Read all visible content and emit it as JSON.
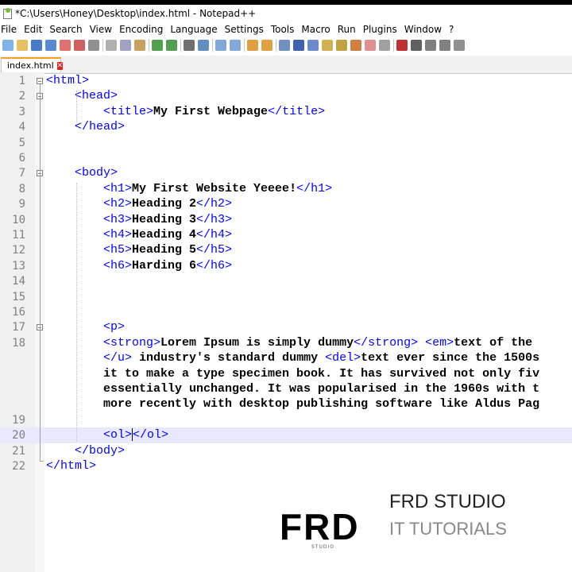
{
  "window": {
    "title": "*C:\\Users\\Honey\\Desktop\\index.html - Notepad++"
  },
  "menu": [
    "File",
    "Edit",
    "Search",
    "View",
    "Encoding",
    "Language",
    "Settings",
    "Tools",
    "Macro",
    "Run",
    "Plugins",
    "Window",
    "?"
  ],
  "tab": {
    "label": "index.html"
  },
  "editor": {
    "lines": [
      {
        "n": "1",
        "parts": [
          [
            "tag",
            "<html>"
          ]
        ]
      },
      {
        "n": "2",
        "parts": [
          [
            "sp",
            "    "
          ],
          [
            "tag",
            "<head>"
          ]
        ]
      },
      {
        "n": "3",
        "parts": [
          [
            "sp",
            "        "
          ],
          [
            "tag",
            "<title>"
          ],
          [
            "txt",
            "My First Webpage"
          ],
          [
            "tag",
            "</title>"
          ]
        ]
      },
      {
        "n": "4",
        "parts": [
          [
            "sp",
            "    "
          ],
          [
            "tag",
            "</head>"
          ]
        ]
      },
      {
        "n": "5",
        "parts": []
      },
      {
        "n": "6",
        "parts": []
      },
      {
        "n": "7",
        "parts": [
          [
            "sp",
            "    "
          ],
          [
            "tag",
            "<body>"
          ]
        ]
      },
      {
        "n": "8",
        "parts": [
          [
            "sp",
            "        "
          ],
          [
            "tag",
            "<h1>"
          ],
          [
            "txt",
            "My First Website Yeeee!"
          ],
          [
            "tag",
            "</h1>"
          ]
        ]
      },
      {
        "n": "9",
        "parts": [
          [
            "sp",
            "        "
          ],
          [
            "tag",
            "<h2>"
          ],
          [
            "txt",
            "Heading 2"
          ],
          [
            "tag",
            "</h2>"
          ]
        ]
      },
      {
        "n": "10",
        "parts": [
          [
            "sp",
            "        "
          ],
          [
            "tag",
            "<h3>"
          ],
          [
            "txt",
            "Heading 3"
          ],
          [
            "tag",
            "</h3>"
          ]
        ]
      },
      {
        "n": "11",
        "parts": [
          [
            "sp",
            "        "
          ],
          [
            "tag",
            "<h4>"
          ],
          [
            "txt",
            "Heading 4"
          ],
          [
            "tag",
            "</h4>"
          ]
        ]
      },
      {
        "n": "12",
        "parts": [
          [
            "sp",
            "        "
          ],
          [
            "tag",
            "<h5>"
          ],
          [
            "txt",
            "Heading 5"
          ],
          [
            "tag",
            "</h5>"
          ]
        ]
      },
      {
        "n": "13",
        "parts": [
          [
            "sp",
            "        "
          ],
          [
            "tag",
            "<h6>"
          ],
          [
            "txt",
            "Harding 6"
          ],
          [
            "tag",
            "</h6>"
          ]
        ]
      },
      {
        "n": "14",
        "parts": []
      },
      {
        "n": "15",
        "parts": []
      },
      {
        "n": "16",
        "parts": []
      },
      {
        "n": "17",
        "parts": [
          [
            "sp",
            "        "
          ],
          [
            "tag",
            "<p>"
          ]
        ]
      },
      {
        "n": "18",
        "parts": [
          [
            "sp",
            "        "
          ],
          [
            "tag",
            "<strong>"
          ],
          [
            "txt",
            "Lorem Ipsum is simply dummy"
          ],
          [
            "tag",
            "</strong>"
          ],
          [
            "txt",
            " "
          ],
          [
            "tag",
            "<em>"
          ],
          [
            "txt",
            "text of the "
          ]
        ]
      },
      {
        "n": "",
        "parts": [
          [
            "sp",
            "        "
          ],
          [
            "tag",
            "</u>"
          ],
          [
            "txt",
            " industry's standard dummy "
          ],
          [
            "tag",
            "<del>"
          ],
          [
            "txt",
            "text ever since the 1500s"
          ]
        ]
      },
      {
        "n": "",
        "parts": [
          [
            "sp",
            "        "
          ],
          [
            "txt",
            "it to make a type specimen book. It has survived not only fiv"
          ]
        ]
      },
      {
        "n": "",
        "parts": [
          [
            "sp",
            "        "
          ],
          [
            "txt",
            "essentially unchanged. It was popularised in the 1960s with t"
          ]
        ]
      },
      {
        "n": "",
        "parts": [
          [
            "sp",
            "        "
          ],
          [
            "txt",
            "more recently with desktop publishing software like Aldus Pag"
          ]
        ]
      },
      {
        "n": "19",
        "parts": []
      },
      {
        "n": "20",
        "parts": [
          [
            "sp",
            "        "
          ],
          [
            "tag",
            "<ol>"
          ],
          [
            "caret",
            ""
          ],
          [
            "tag",
            "</ol>"
          ]
        ]
      },
      {
        "n": "21",
        "parts": [
          [
            "sp",
            "    "
          ],
          [
            "tag",
            "</body>"
          ]
        ]
      },
      {
        "n": "22",
        "parts": [
          [
            "tag",
            "</html>"
          ]
        ]
      }
    ]
  },
  "branding": {
    "logo": "FRD",
    "logo_sub": "STUDIO",
    "title": "FRD STUDIO",
    "subtitle": "IT TUTORIALS"
  }
}
